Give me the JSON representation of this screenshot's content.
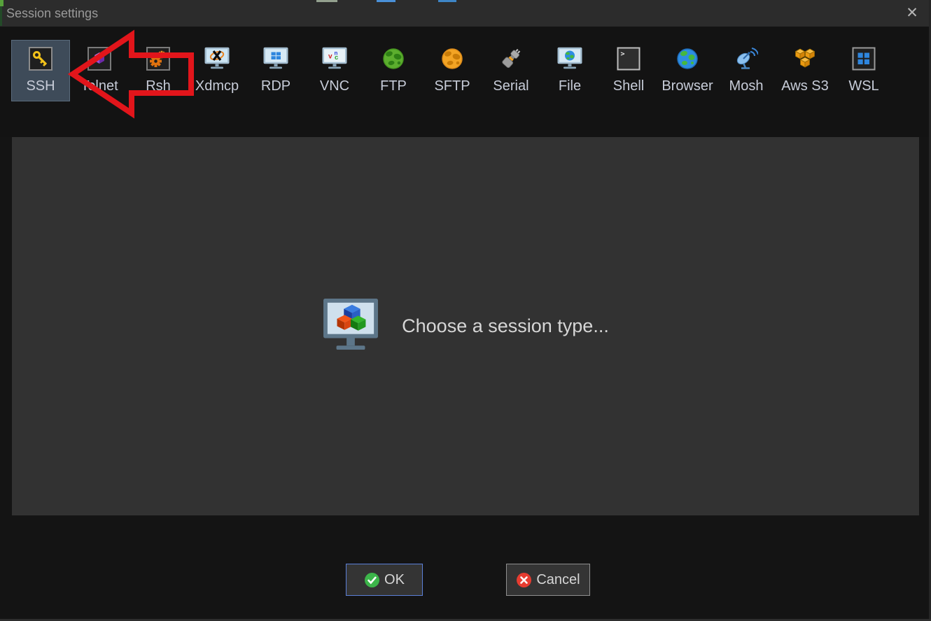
{
  "window": {
    "title": "Session settings",
    "close_icon": "✕"
  },
  "toolbar": {
    "items": [
      {
        "label": "SSH",
        "icon": "key-icon",
        "selected": true
      },
      {
        "label": "Telnet",
        "icon": "purple-cube-icon",
        "selected": false
      },
      {
        "label": "Rsh",
        "icon": "gears-icon",
        "selected": false
      },
      {
        "label": "Xdmcp",
        "icon": "x11-monitor-icon",
        "selected": false
      },
      {
        "label": "RDP",
        "icon": "windows-monitor-icon",
        "selected": false
      },
      {
        "label": "VNC",
        "icon": "vnc-monitor-icon",
        "selected": false
      },
      {
        "label": "FTP",
        "icon": "green-globe-icon",
        "selected": false
      },
      {
        "label": "SFTP",
        "icon": "orange-globe-icon",
        "selected": false
      },
      {
        "label": "Serial",
        "icon": "plug-icon",
        "selected": false
      },
      {
        "label": "File",
        "icon": "globe-monitor-icon",
        "selected": false
      },
      {
        "label": "Shell",
        "icon": "terminal-icon",
        "selected": false
      },
      {
        "label": "Browser",
        "icon": "blue-globe-icon",
        "selected": false
      },
      {
        "label": "Mosh",
        "icon": "satellite-dish-icon",
        "selected": false
      },
      {
        "label": "Aws S3",
        "icon": "aws-cubes-icon",
        "selected": false
      },
      {
        "label": "WSL",
        "icon": "windows-logo-icon",
        "selected": false
      }
    ]
  },
  "main": {
    "placeholder_message": "Choose a session type..."
  },
  "footer": {
    "ok_label": "OK",
    "cancel_label": "Cancel"
  },
  "annotation": {
    "type": "red-arrow",
    "direction": "left",
    "target": "SSH"
  },
  "colors": {
    "selected_item_bg": "#3e4b59",
    "ok_border_blue": "#5c80d8",
    "ok_green": "#3cb54a",
    "cancel_red": "#e63c30",
    "arrow_red": "#e2151b",
    "panel_bg": "#323232",
    "titlebar_bg": "#2c2c2c"
  }
}
